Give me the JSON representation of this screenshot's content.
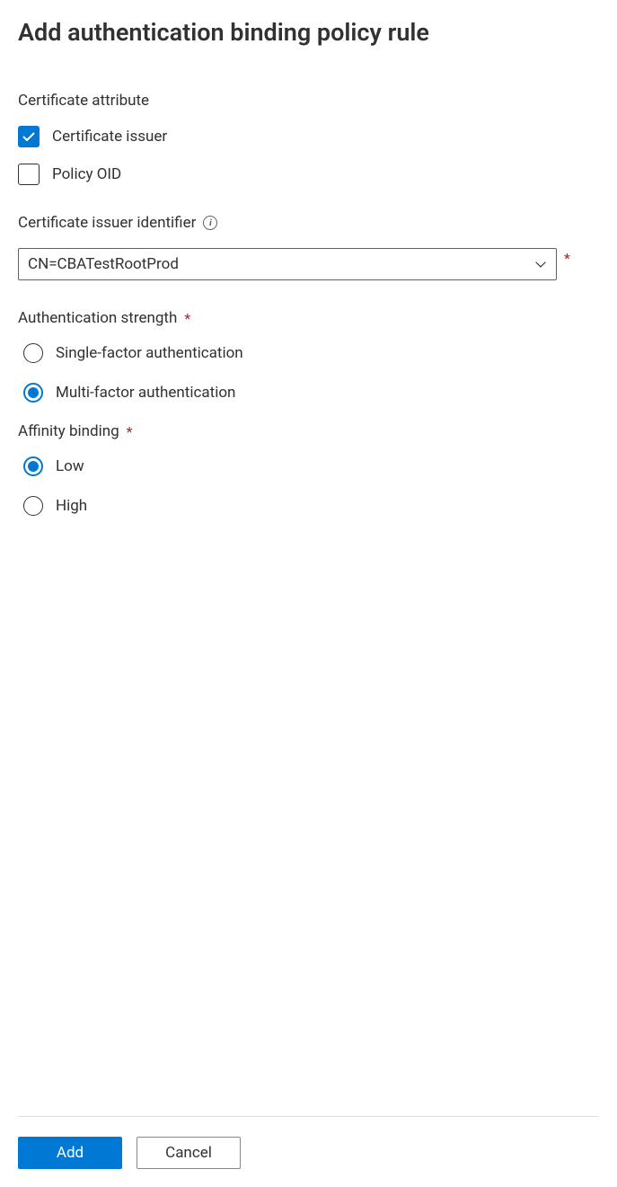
{
  "title": "Add authentication binding policy rule",
  "certAttr": {
    "label": "Certificate attribute",
    "options": [
      {
        "label": "Certificate issuer",
        "checked": true
      },
      {
        "label": "Policy OID",
        "checked": false
      }
    ]
  },
  "issuerId": {
    "label": "Certificate issuer identifier",
    "value": "CN=CBATestRootProd"
  },
  "authStrength": {
    "label": "Authentication strength",
    "options": [
      {
        "label": "Single-factor authentication",
        "selected": false
      },
      {
        "label": "Multi-factor authentication",
        "selected": true
      }
    ]
  },
  "affinity": {
    "label": "Affinity binding",
    "options": [
      {
        "label": "Low",
        "selected": true
      },
      {
        "label": "High",
        "selected": false
      }
    ]
  },
  "buttons": {
    "add": "Add",
    "cancel": "Cancel"
  }
}
